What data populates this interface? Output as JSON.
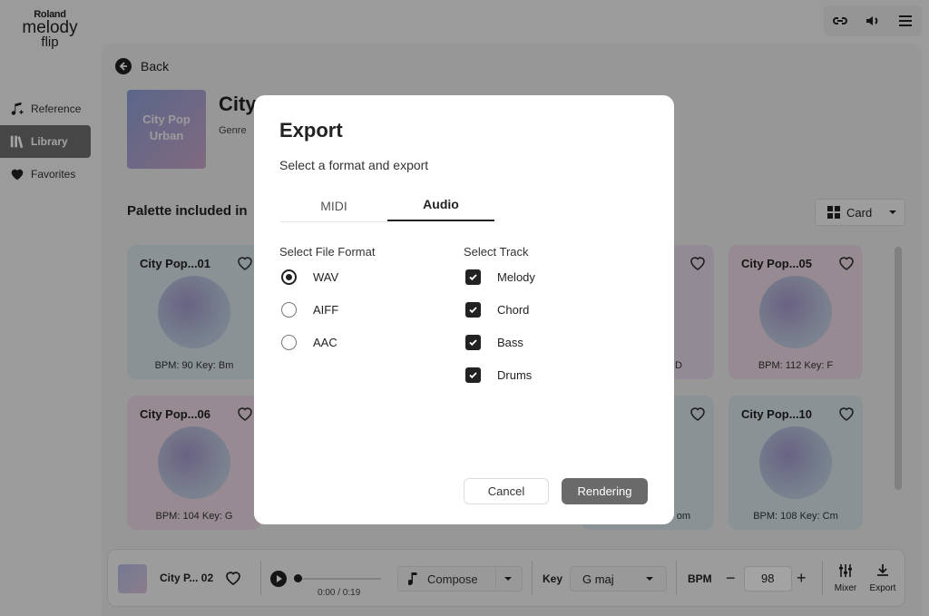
{
  "brand": {
    "maker": "Roland",
    "name_line1": "melody",
    "name_line2": "flip"
  },
  "sidebar": {
    "items": [
      {
        "label": "Reference",
        "icon": "note-sparkle-icon"
      },
      {
        "label": "Library",
        "icon": "library-icon",
        "active": true
      },
      {
        "label": "Favorites",
        "icon": "heart-icon"
      }
    ]
  },
  "topbar": {
    "icons": [
      "link-icon",
      "volume-icon",
      "menu-icon"
    ]
  },
  "main": {
    "back_label": "Back",
    "cover_text": "City Pop\nUrban",
    "title": "City",
    "genre": "Genre",
    "palette_title": "Palette included in",
    "view_select": "Card",
    "cards": [
      {
        "title": "City Pop...01",
        "meta": "BPM: 90  Key: Bm",
        "color": "#d8e4ea"
      },
      {
        "title": "City Pop...05",
        "meta": "BPM: 112  Key: F",
        "color": "#ecd8e4"
      },
      {
        "title": "City Pop...06",
        "meta": "BPM: 104  Key: G",
        "color": "#ecd8e4"
      },
      {
        "title": "City Pop...10",
        "meta": "BPM: 108  Key: Cm",
        "color": "#d8e4ea"
      }
    ],
    "partial_meta_1": "D",
    "partial_meta_2": "om"
  },
  "player": {
    "track": "City P... 02",
    "time": "0:00 / 0:19",
    "compose_label": "Compose",
    "key_label": "Key",
    "key_value": "G maj",
    "bpm_label": "BPM",
    "bpm_value": "98",
    "mixer_label": "Mixer",
    "export_label": "Export"
  },
  "modal": {
    "title": "Export",
    "subtitle": "Select a format and export",
    "tabs": [
      {
        "label": "MIDI",
        "active": false
      },
      {
        "label": "Audio",
        "active": true
      }
    ],
    "format_label": "Select File Format",
    "formats": [
      {
        "label": "WAV",
        "selected": true
      },
      {
        "label": "AIFF",
        "selected": false
      },
      {
        "label": "AAC",
        "selected": false
      }
    ],
    "track_label": "Select Track",
    "tracks": [
      {
        "label": "Melody",
        "checked": true
      },
      {
        "label": "Chord",
        "checked": true
      },
      {
        "label": "Bass",
        "checked": true
      },
      {
        "label": "Drums",
        "checked": true
      }
    ],
    "cancel_label": "Cancel",
    "render_label": "Rendering"
  }
}
